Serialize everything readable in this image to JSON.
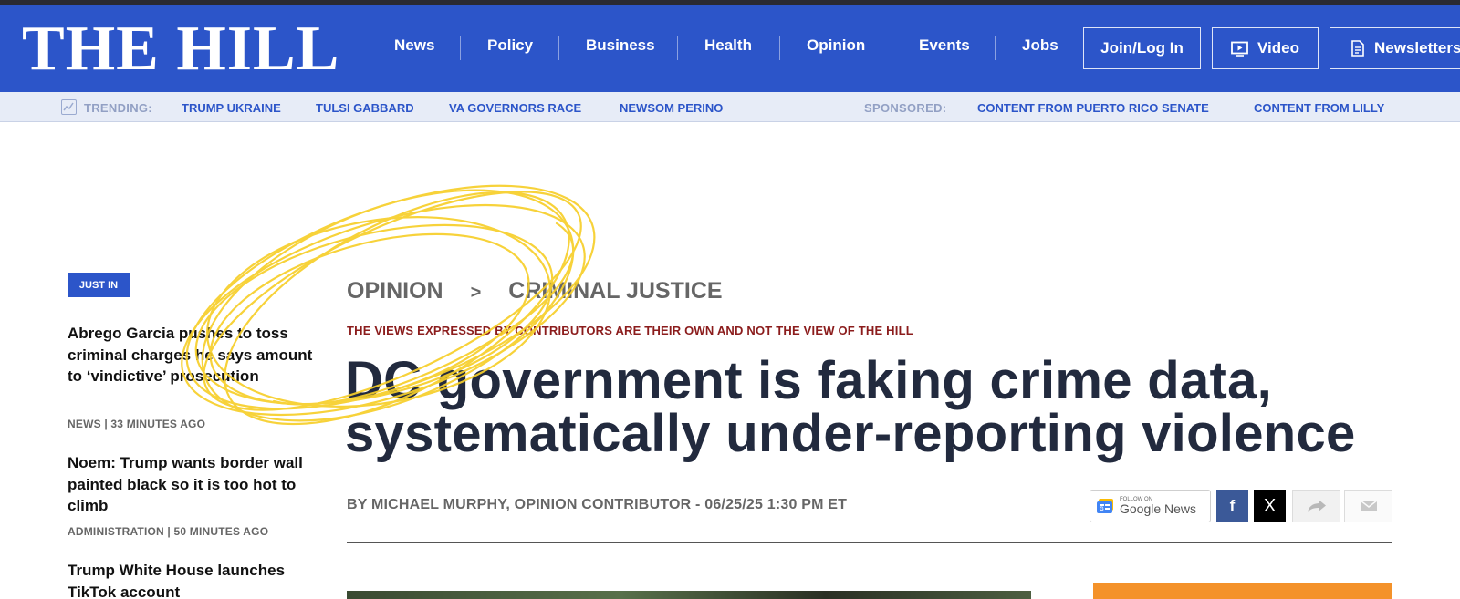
{
  "header": {
    "logo": "THE HILL",
    "nav": [
      "News",
      "Policy",
      "Business",
      "Health",
      "Opinion",
      "Events",
      "Jobs"
    ],
    "login_label": "Join/Log In",
    "video_label": "Video",
    "newsletters_label": "Newsletters",
    "brand_color": "#2c55c9"
  },
  "trending": {
    "label": "TRENDING:",
    "links": [
      "TRUMP UKRAINE",
      "TULSI GABBARD",
      "VA GOVERNORS RACE",
      "NEWSOM PERINO"
    ],
    "sponsored_label": "SPONSORED:",
    "sponsored_links": [
      "CONTENT FROM PUERTO RICO SENATE",
      "CONTENT FROM LILLY"
    ]
  },
  "sidebar": {
    "badge": "JUST IN",
    "items": [
      {
        "headline": "Abrego Garcia pushes to toss criminal charges he says amount to ‘vindictive’ prosecution",
        "meta": "NEWS | 33 MINUTES AGO"
      },
      {
        "headline": "Noem: Trump wants border wall painted black so it is too hot to climb",
        "meta": "ADMINISTRATION | 50 MINUTES AGO"
      },
      {
        "headline": "Trump White House launches TikTok account",
        "meta": ""
      }
    ]
  },
  "article": {
    "breadcrumb": [
      "OPINION",
      ">",
      "CRIMINAL JUSTICE"
    ],
    "disclaimer": "THE VIEWS EXPRESSED BY CONTRIBUTORS ARE THEIR OWN AND NOT THE VIEW OF THE HILL",
    "headline": "DC government is faking crime data, systematically under-reporting violence",
    "byline": "BY MICHAEL MURPHY, OPINION CONTRIBUTOR - 06/25/25 1:30 PM ET"
  },
  "share": {
    "gnews_small": "FOLLOW ON",
    "gnews_label": "Google News",
    "facebook": "f",
    "x": "X"
  }
}
